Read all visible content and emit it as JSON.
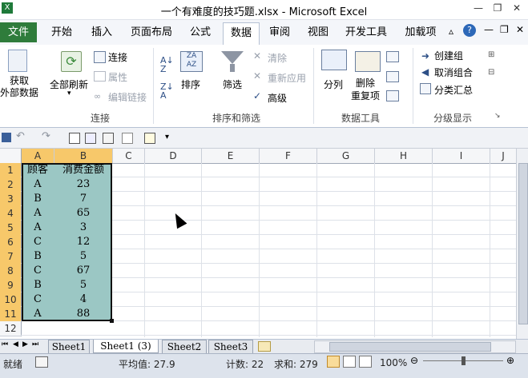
{
  "window": {
    "title": "一个有难度的技巧题.xlsx - Microsoft Excel"
  },
  "tabs": [
    "文件",
    "开始",
    "插入",
    "页面布局",
    "公式",
    "数据",
    "审阅",
    "视图",
    "开发工具",
    "加载项"
  ],
  "active_tab": "数据",
  "ribbon": {
    "get_external": "获取\n外部数据",
    "refresh_all": "全部刷新",
    "connections": "连接",
    "properties": "属性",
    "edit_links": "编辑链接",
    "group_connections": "连接",
    "sort": "排序",
    "filter": "筛选",
    "clear": "清除",
    "reapply": "重新应用",
    "advanced": "高级",
    "group_sort": "排序和筛选",
    "text_to_columns": "分列",
    "remove_duplicates": "删除\n重复项",
    "group_datatools": "数据工具",
    "group": "创建组",
    "ungroup": "取消组合",
    "subtotal": "分类汇总",
    "group_outline": "分级显示"
  },
  "grid": {
    "columns": [
      "A",
      "B",
      "C",
      "D",
      "E",
      "F",
      "G",
      "H",
      "I",
      "J"
    ],
    "rows": [
      "1",
      "2",
      "3",
      "4",
      "5",
      "6",
      "7",
      "8",
      "9",
      "10",
      "11",
      "12"
    ],
    "data": [
      [
        "顾客",
        "消费金额"
      ],
      [
        "A",
        "23"
      ],
      [
        "B",
        "7"
      ],
      [
        "A",
        "65"
      ],
      [
        "A",
        "3"
      ],
      [
        "C",
        "12"
      ],
      [
        "B",
        "5"
      ],
      [
        "C",
        "67"
      ],
      [
        "B",
        "5"
      ],
      [
        "C",
        "4"
      ],
      [
        "A",
        "88"
      ]
    ]
  },
  "sheets": [
    "Sheet1",
    "Sheet1 (3)",
    "Sheet2",
    "Sheet3"
  ],
  "active_sheet": "Sheet1 (3)",
  "status": {
    "ready": "就绪",
    "average": "平均值: 27.9",
    "count": "计数: 22",
    "sum": "求和: 279",
    "zoom": "100%"
  }
}
